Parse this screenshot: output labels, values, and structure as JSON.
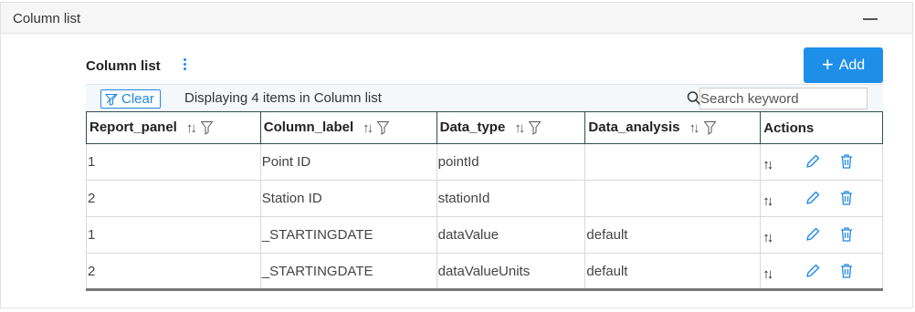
{
  "panel": {
    "title": "Column list"
  },
  "section": {
    "title": "Column list"
  },
  "toolbar": {
    "add_label": "Add",
    "clear_label": "Clear",
    "display_text": "Displaying 4 items in Column list",
    "search_placeholder": "Search keyword"
  },
  "table": {
    "headers": [
      "Report_panel",
      "Column_label",
      "Data_type",
      "Data_analysis",
      "Actions"
    ],
    "rows": [
      {
        "report_panel": "1",
        "column_label": "Point ID",
        "data_type": "pointId",
        "data_analysis": ""
      },
      {
        "report_panel": "2",
        "column_label": "Station ID",
        "data_type": "stationId",
        "data_analysis": ""
      },
      {
        "report_panel": "1",
        "column_label": "_STARTINGDATE",
        "data_type": "dataValue",
        "data_analysis": "default"
      },
      {
        "report_panel": "2",
        "column_label": "_STARTINGDATE",
        "data_type": "dataValueUnits",
        "data_analysis": "default"
      }
    ]
  },
  "colors": {
    "accent": "#1e8fe8",
    "header_border": "#2f4f4f"
  },
  "icons": [
    "collapse-icon",
    "kebab-menu-icon",
    "plus-icon",
    "filter-icon",
    "search-icon",
    "sort-icon",
    "edit-icon",
    "delete-icon"
  ]
}
